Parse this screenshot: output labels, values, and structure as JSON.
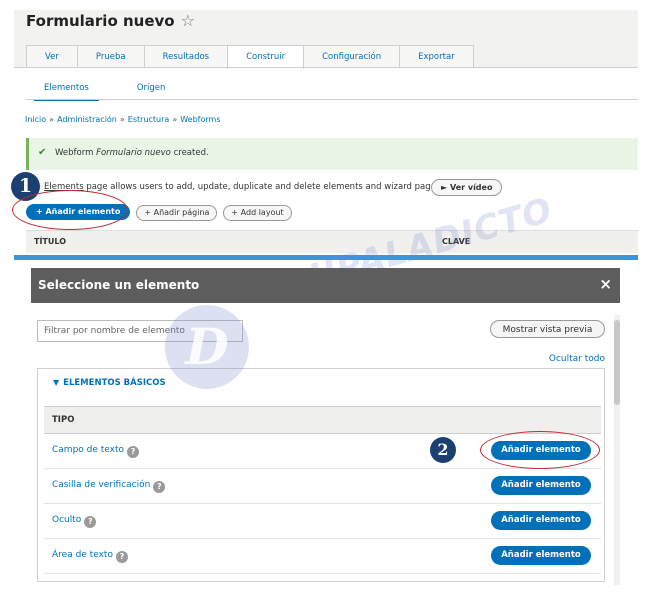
{
  "page": {
    "title": "Formulario nuevo",
    "tabs": [
      {
        "label": "Ver"
      },
      {
        "label": "Prueba"
      },
      {
        "label": "Resultados"
      },
      {
        "label": "Construir"
      },
      {
        "label": "Configuración"
      },
      {
        "label": "Exportar"
      }
    ],
    "active_tab": "Construir",
    "subtabs": [
      {
        "label": "Elementos"
      },
      {
        "label": "Origen"
      }
    ],
    "breadcrumb": [
      "Inicio",
      "Administración",
      "Estructura",
      "Webforms"
    ],
    "breadcrumb_sep": "»",
    "status": {
      "prefix": "Webform",
      "name": "Formulario nuevo",
      "suffix": "created."
    },
    "info": {
      "link": "Elements",
      "text": "page allows users to add, update, duplicate and delete elements and wizard pages."
    },
    "video_button": "► Ver vídeo",
    "buttons": {
      "add_element": "+ Añadir elemento",
      "add_page": "+ Añadir página",
      "add_layout": "+ Add layout"
    },
    "table_headers": {
      "title": "TÍTULO",
      "key": "CLAVE"
    }
  },
  "modal": {
    "title": "Seleccione un elemento",
    "close": "×",
    "filter_placeholder": "Filtrar por nombre de elemento",
    "preview_button": "Mostrar vista previa",
    "hide_all": "Ocultar todo",
    "group_label": "ELEMENTOS BÁSICOS",
    "type_header": "TIPO",
    "help_glyph": "?",
    "rows": [
      {
        "label": "Campo de texto",
        "button": "Añadir elemento"
      },
      {
        "label": "Casilla de verificación",
        "button": "Añadir elemento"
      },
      {
        "label": "Oculto",
        "button": "Añadir elemento"
      },
      {
        "label": "Área de texto",
        "button": "Añadir elemento"
      }
    ]
  },
  "annotations": {
    "marker_1": "1",
    "marker_2": "2"
  },
  "watermark": {
    "logo_letter": "D",
    "text": "DRUPALADICTO"
  },
  "colors": {
    "link": "#0071b8",
    "primary": "#0071b8",
    "success_border": "#77b259",
    "modal_header": "#5d5d5d",
    "annotation": "#1c3f72",
    "highlight_ring": "#c0282d"
  }
}
